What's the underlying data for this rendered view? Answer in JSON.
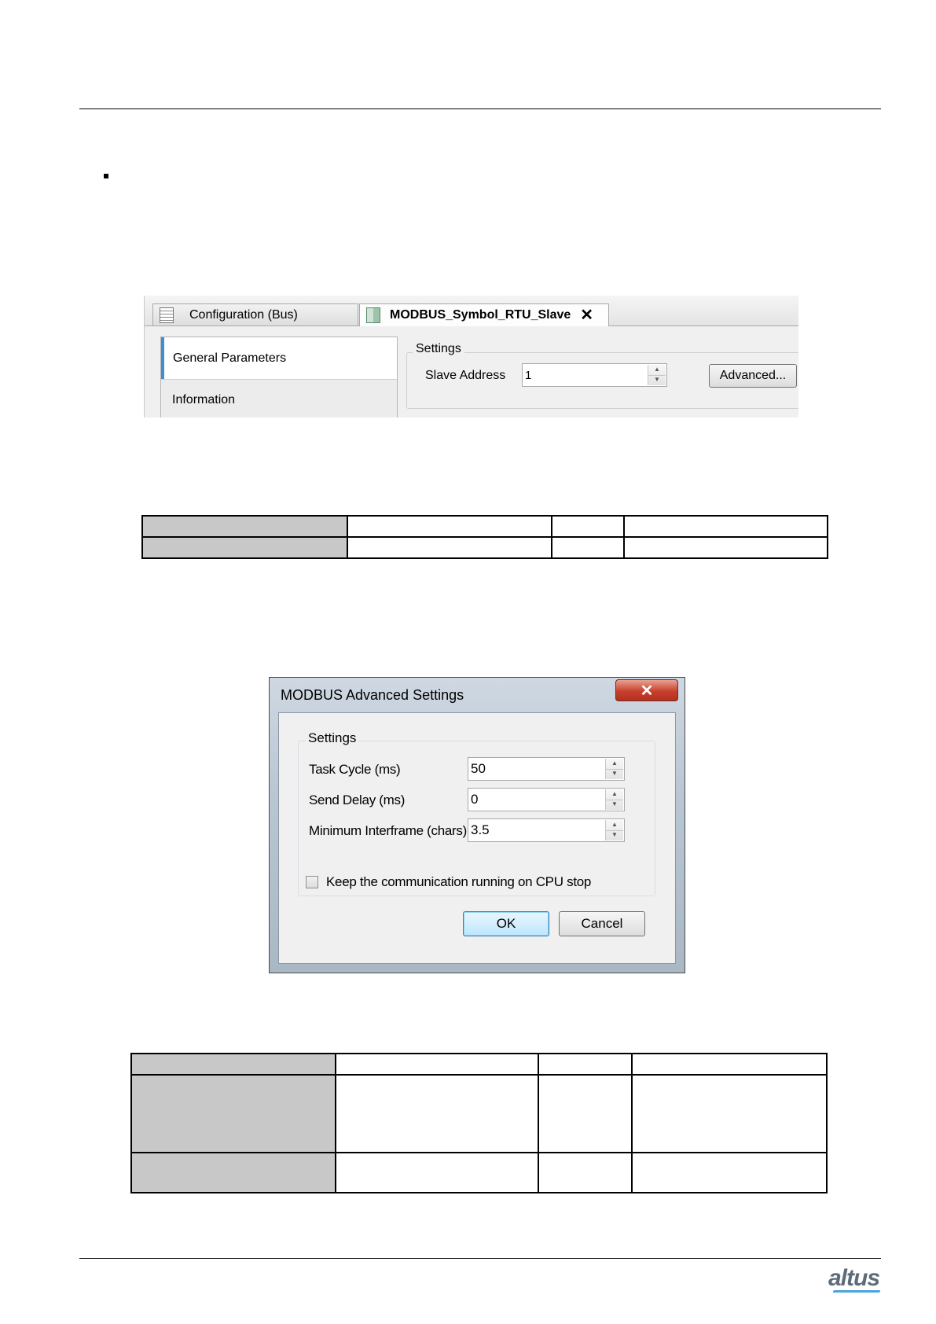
{
  "editor": {
    "tabs": [
      {
        "label": "Configuration (Bus)"
      },
      {
        "label": "MODBUS_Symbol_RTU_Slave"
      }
    ],
    "tab_close_glyph": "✕",
    "nav": [
      {
        "label": "General Parameters"
      },
      {
        "label": "Information"
      }
    ],
    "settings_legend": "Settings",
    "slave_address_label": "Slave Address",
    "slave_address_value": "1",
    "advanced_button": "Advanced..."
  },
  "dialog": {
    "title": "MODBUS Advanced Settings",
    "close_glyph": "✕",
    "group_legend": "Settings",
    "fields": [
      {
        "label": "Task Cycle (ms)",
        "value": "50"
      },
      {
        "label": "Send Delay (ms)",
        "value": "0"
      },
      {
        "label": "Minimum Interframe (chars)",
        "value": "3.5"
      }
    ],
    "checkbox_label": "Keep the communication running on CPU stop",
    "checkbox_checked": false,
    "ok_button": "OK",
    "cancel_button": "Cancel"
  },
  "footer": {
    "logo_text": "altus"
  },
  "colors": {
    "table_header_shade": "#c8c8c8",
    "active_nav_accent": "#3b8fd9",
    "close_button_red": "#c7402d",
    "logo_accent": "#4aa3df"
  }
}
